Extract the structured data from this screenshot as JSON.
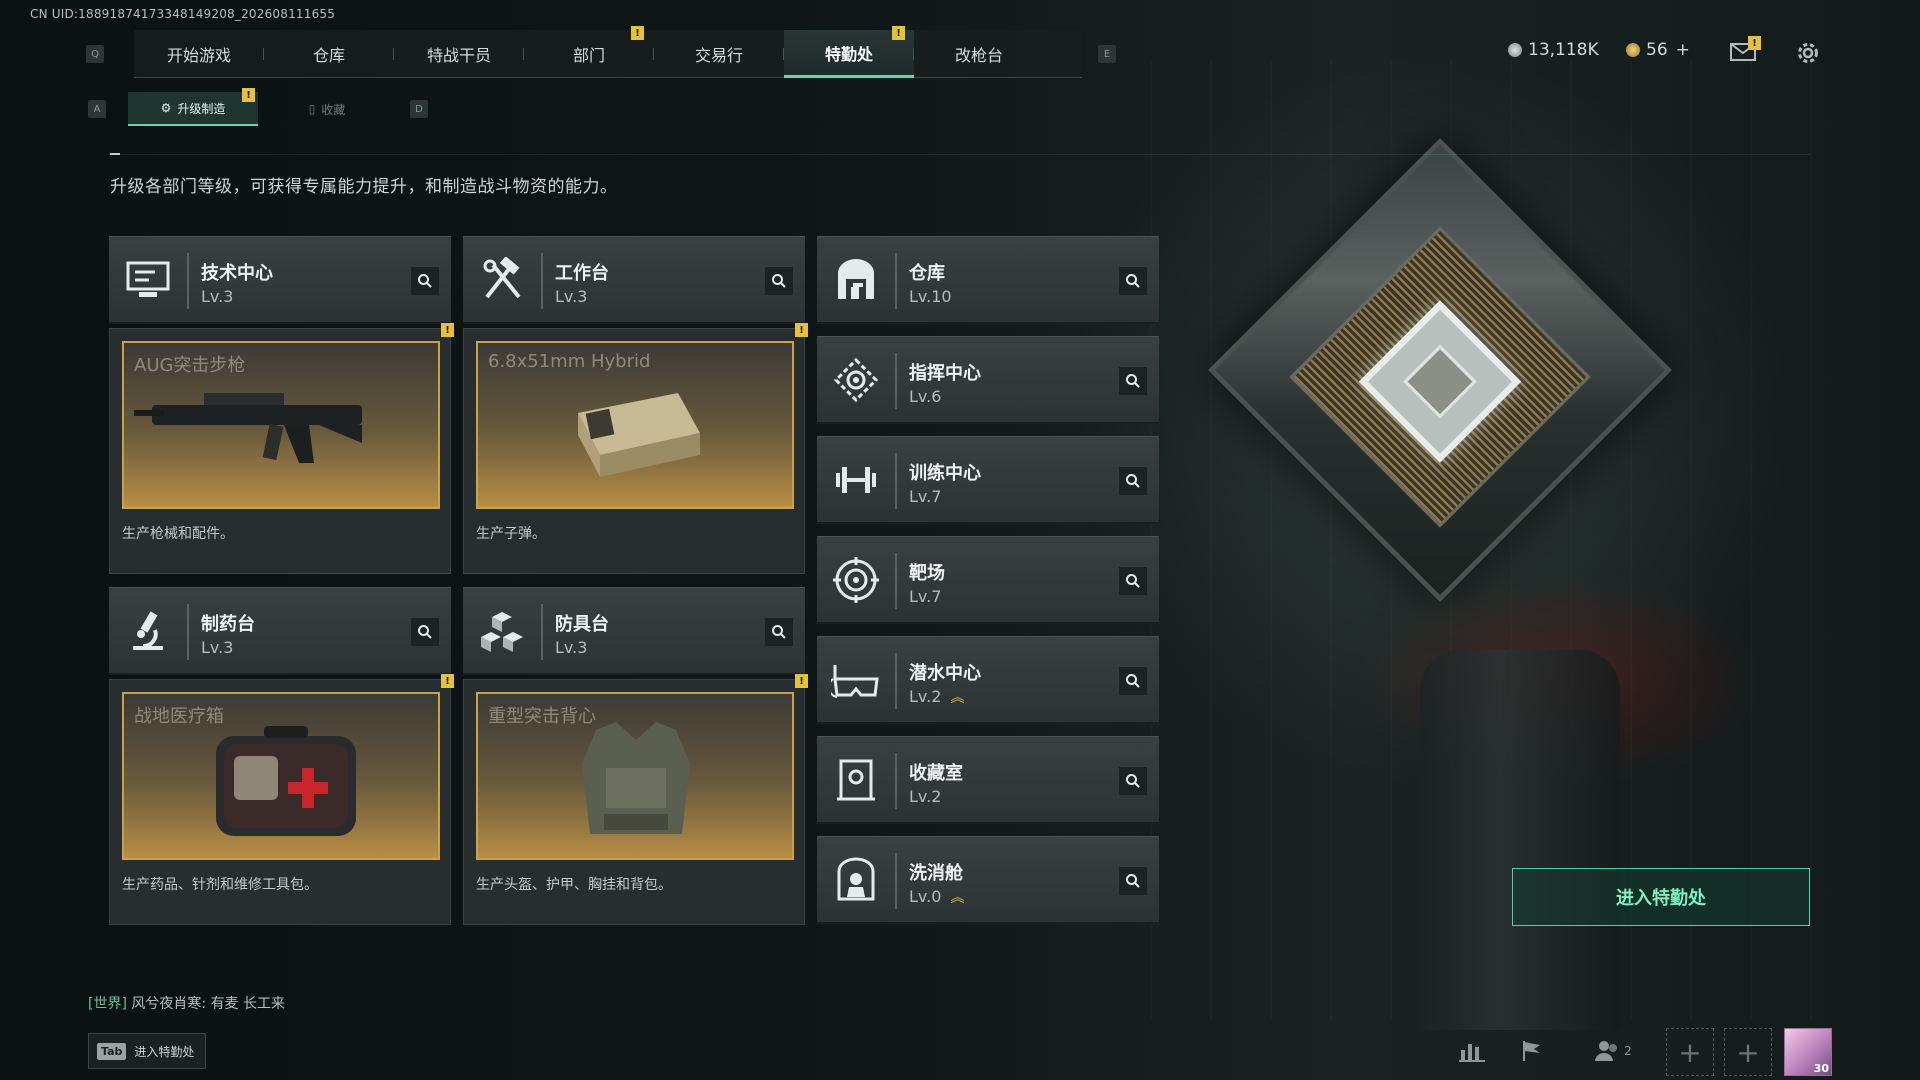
{
  "uid": "CN UID:18891874173348149208_202608111655",
  "nav": {
    "key_left": "Q",
    "key_right": "E",
    "tabs": [
      {
        "label": "开始游戏"
      },
      {
        "label": "仓库"
      },
      {
        "label": "特战干员"
      },
      {
        "label": "部门"
      },
      {
        "label": "交易行"
      },
      {
        "label": "特勤处"
      },
      {
        "label": "改枪台"
      }
    ],
    "badge": "!"
  },
  "currency": {
    "coins": "13,118K",
    "tokens": "56",
    "add": "+"
  },
  "subnav": {
    "key_left": "A",
    "key_right": "D",
    "tabs": [
      {
        "label": "升级制造"
      },
      {
        "label": "收藏"
      }
    ]
  },
  "description": "升级各部门等级，可获得专属能力提升，和制造战斗物资的能力。",
  "depts_left": [
    {
      "name": "技术中心",
      "level": "Lv.3",
      "icon": "computer-icon",
      "craft_item": "AUG突击步枪",
      "craft_desc": "生产枪械和配件。"
    },
    {
      "name": "工作台",
      "level": "Lv.3",
      "icon": "tools-icon",
      "craft_item": "6.8x51mm Hybrid",
      "craft_desc": "生产子弹。"
    },
    {
      "name": "制药台",
      "level": "Lv.3",
      "icon": "microscope-icon",
      "craft_item": "战地医疗箱",
      "craft_desc": "生产药品、针剂和维修工具包。"
    },
    {
      "name": "防具台",
      "level": "Lv.3",
      "icon": "cubes-icon",
      "craft_item": "重型突击背心",
      "craft_desc": "生产头盔、护甲、胸挂和背包。"
    }
  ],
  "depts_right": [
    {
      "name": "仓库",
      "level": "Lv.10",
      "icon": "warehouse-icon"
    },
    {
      "name": "指挥中心",
      "level": "Lv.6",
      "icon": "command-icon"
    },
    {
      "name": "训练中心",
      "level": "Lv.7",
      "icon": "dumbbell-icon"
    },
    {
      "name": "靶场",
      "level": "Lv.7",
      "icon": "target-icon"
    },
    {
      "name": "潜水中心",
      "level": "Lv.2",
      "icon": "goggles-icon"
    },
    {
      "name": "收藏室",
      "level": "Lv.2",
      "icon": "collection-icon"
    },
    {
      "name": "洗消舱",
      "level": "Lv.0",
      "icon": "decon-icon"
    }
  ],
  "enter_button": "进入特勤处",
  "chat": {
    "channel": "[世界]",
    "sender": "风兮夜肖寒",
    "message": "有麦 长工来"
  },
  "tab_hint": {
    "key": "Tab",
    "label": "进入特勤处"
  },
  "bottom": {
    "friends_count": "2",
    "avatar_level": "30"
  },
  "colors": {
    "accent": "#5fd9b0",
    "badge": "#e6c23c",
    "craft_border": "#c9a24a"
  }
}
